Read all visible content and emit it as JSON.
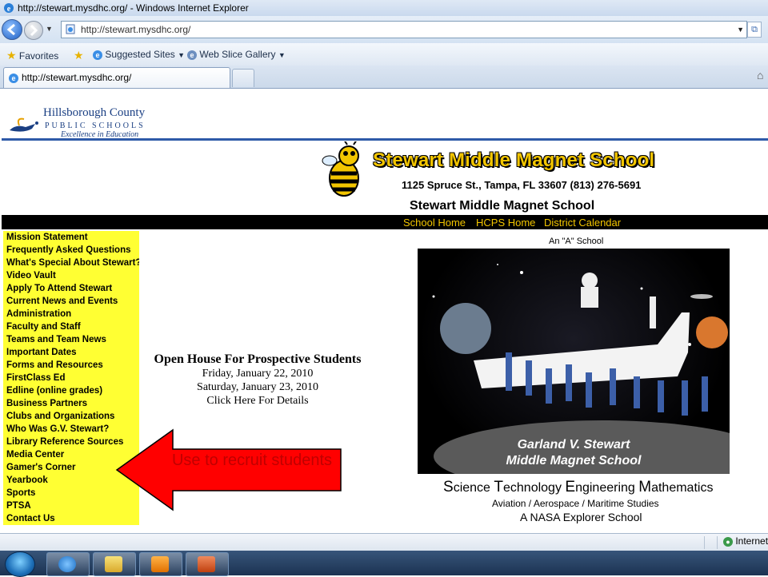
{
  "browser": {
    "title_bar": "http://stewart.mysdhc.org/ - Windows Internet Explorer",
    "address_url": "http://stewart.mysdhc.org/",
    "favorites": {
      "favorites_label": "Favorites",
      "suggested_sites": "Suggested Sites",
      "web_slice_gallery": "Web Slice Gallery"
    },
    "tab_label": "http://stewart.mysdhc.org/",
    "status_zone": "Internet"
  },
  "page": {
    "district": {
      "line1": "Hillsborough County",
      "line2": "PUBLIC SCHOOLS",
      "line3": "Excellence in Education"
    },
    "school_title": "Stewart Middle Magnet School",
    "address": "1125 Spruce St., Tampa, FL 33607 (813) 276-5691",
    "subtitle": "Stewart Middle Magnet School",
    "top_links": [
      "School Home",
      "HCPS Home",
      "District Calendar"
    ],
    "sidebar": [
      "Mission Statement",
      "Frequently Asked Questions",
      "What's Special About Stewart?",
      "Video Vault",
      "Apply To Attend Stewart",
      "Current News and Events",
      "Administration",
      "Faculty and Staff",
      "Teams and Team News",
      "Important Dates",
      "Forms and Resources",
      "FirstClass Ed",
      "Edline (online grades)",
      "Business Partners",
      "Clubs and Organizations",
      "Who Was G.V. Stewart?",
      "Library Reference Sources",
      "Media Center",
      "Gamer's Corner",
      "Yearbook",
      "Sports",
      "PTSA",
      "Contact Us"
    ],
    "open_house": {
      "heading": "Open House For Prospective Students",
      "date1": "Friday, January 22, 2010",
      "date2": "Saturday, January 23, 2010",
      "cta": "Click Here For Details"
    },
    "a_school": "An \"A\" School",
    "photo_caption": {
      "line1": "Garland V. Stewart",
      "line2": "Middle Magnet School"
    },
    "stem": {
      "s": "S",
      "science": "cience ",
      "t": "T",
      "technology": "echnology ",
      "e": "E",
      "engineering": "ngineering ",
      "m": "M",
      "mathematics": "athematics"
    },
    "aviation": "Aviation / Aerospace / Maritime Studies",
    "nasa": "A NASA Explorer School"
  },
  "annotation": {
    "text": "Use to recruit students",
    "arrow_color": "#ff0000"
  },
  "colors": {
    "nav_yellow": "#ffff33",
    "title_gold": "#f2c500",
    "district_blue": "#1a3f83"
  }
}
